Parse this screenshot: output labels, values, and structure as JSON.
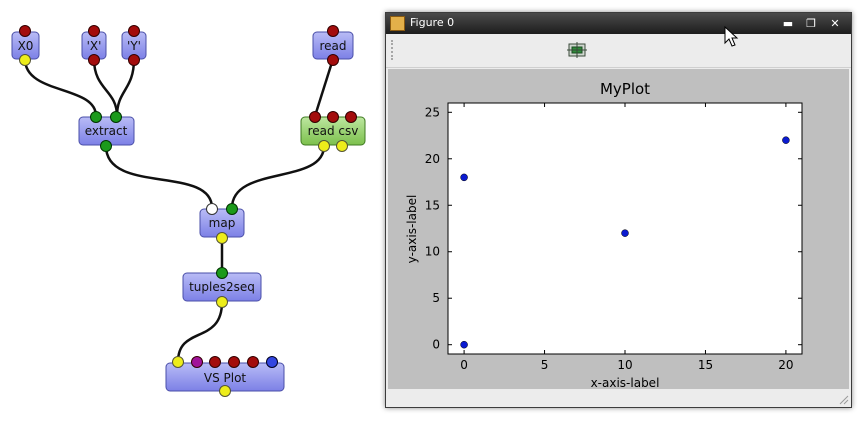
{
  "graph": {
    "nodes": {
      "x0": "X0",
      "x_quote": "'X'",
      "y_quote": "'Y'",
      "read": "read",
      "extract": "extract",
      "read_csv": "read csv",
      "map": "map",
      "tuples2seq": "tuples2seq",
      "vs_plot": "VS Plot"
    },
    "colors": {
      "node_fill": "#8f93ef",
      "csv_fill": "#93d06a",
      "port_red": "#a30c0c",
      "port_green": "#1b9a1b",
      "port_yellow": "#eded1a",
      "port_white": "#ffffff",
      "port_purple": "#a0139a",
      "port_blue": "#3346e0"
    }
  },
  "window": {
    "title": "Figure 0",
    "buttons": {
      "minimize": "▬",
      "maximize": "❐",
      "close": "✕"
    },
    "toolbar_icon": "configure-icon"
  },
  "chart_data": {
    "type": "scatter",
    "title": "MyPlot",
    "xlabel": "x-axis-label",
    "ylabel": "y-axis-label",
    "points": [
      {
        "x": 0,
        "y": 0
      },
      {
        "x": 0,
        "y": 18
      },
      {
        "x": 10,
        "y": 12
      },
      {
        "x": 20,
        "y": 22
      }
    ],
    "xlim": [
      -1,
      21
    ],
    "ylim": [
      -1,
      26
    ],
    "xticks": [
      0,
      5,
      10,
      15,
      20
    ],
    "yticks": [
      0,
      5,
      10,
      15,
      20,
      25
    ],
    "grid": false,
    "marker_color": "#0b1bd0"
  }
}
